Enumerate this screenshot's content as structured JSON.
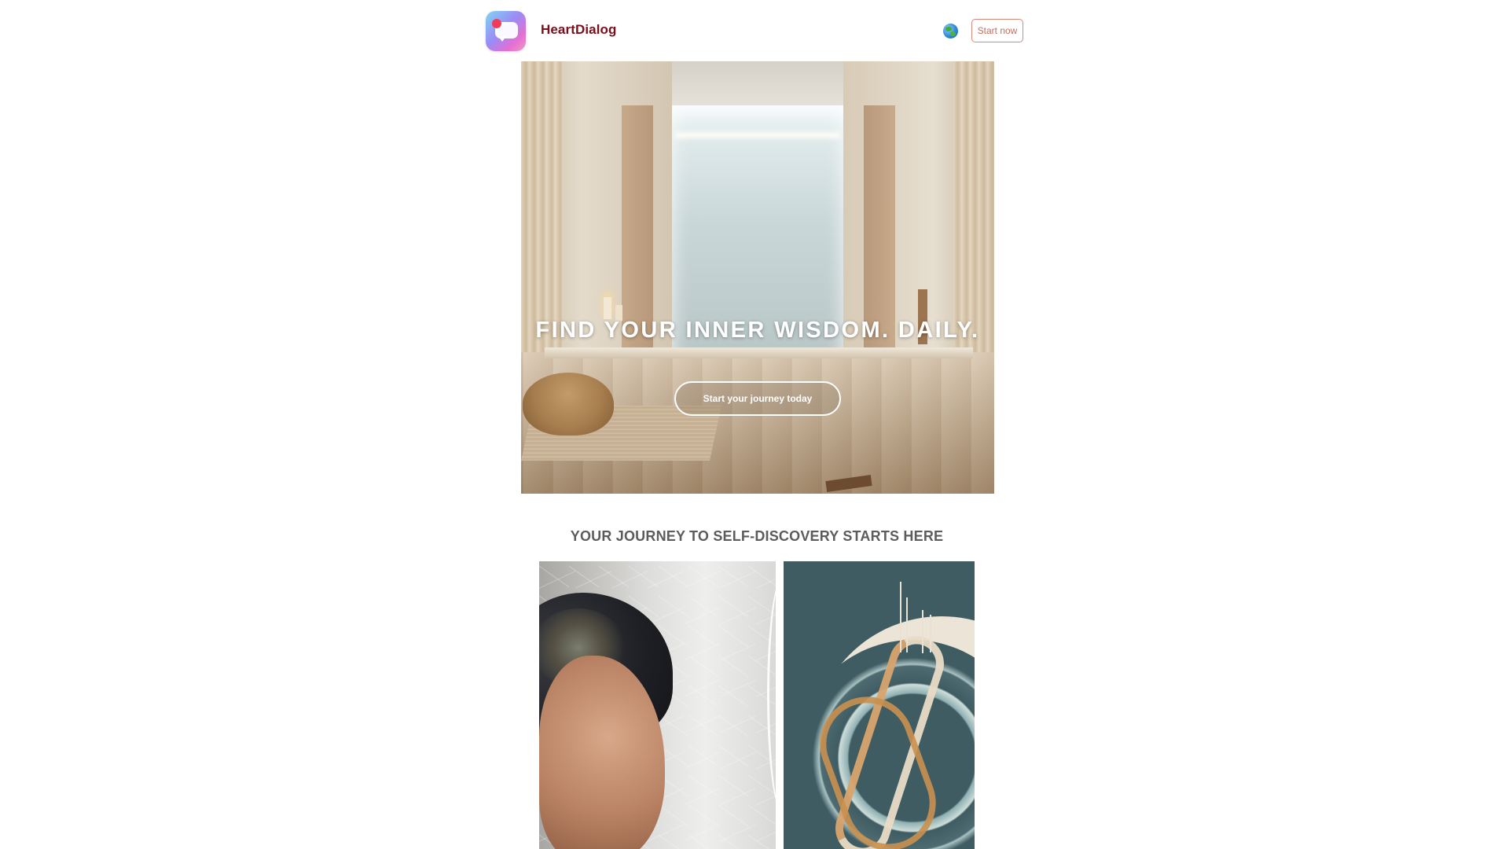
{
  "header": {
    "brand_name": "HeartDialog",
    "start_button_label": "Start now",
    "icons": {
      "logo": "chat-bubble-app-logo",
      "language": "globe-icon"
    }
  },
  "hero": {
    "headline": "FIND YOUR INNER WISDOM. DAILY.",
    "cta_label": "Start your journey today"
  },
  "section": {
    "title": "YOUR JOURNEY TO SELF-DISCOVERY STARTS HERE"
  },
  "colors": {
    "brand_text": "#7a0f1c",
    "start_button_border": "#d88a7a",
    "section_title": "#5c5c5c"
  }
}
